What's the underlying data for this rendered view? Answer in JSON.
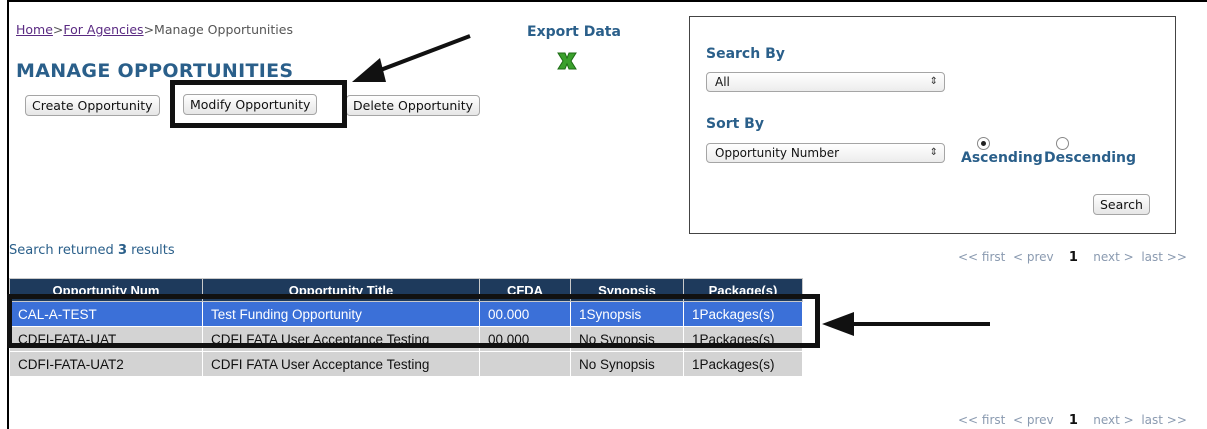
{
  "breadcrumb": {
    "home": "Home",
    "sep1": ">",
    "agencies": "For Agencies",
    "sep2": ">",
    "current": "Manage Opportunities"
  },
  "page_title": "MANAGE OPPORTUNITIES",
  "buttons": {
    "create": "Create Opportunity",
    "modify": "Modify Opportunity",
    "delete": "Delete Opportunity",
    "search": "Search"
  },
  "export": {
    "label": "Export Data",
    "icon": "excel-export-icon"
  },
  "search_panel": {
    "search_by_label": "Search By",
    "search_by_value": "All",
    "sort_by_label": "Sort By",
    "sort_by_value": "Opportunity Number",
    "ascending_label": "Ascending",
    "descending_label": "Descending",
    "order_selected": "Ascending"
  },
  "results": {
    "prefix": "Search returned ",
    "count": "3",
    "suffix": " results"
  },
  "pager": {
    "first": "<< first",
    "prev": "< prev",
    "page": "1",
    "next": "next >",
    "last": "last >>"
  },
  "table": {
    "headers": [
      "Opportunity Num",
      "Opportunity Title",
      "CFDA",
      "Synopsis",
      "Package(s)"
    ],
    "rows": [
      [
        "CAL-A-TEST",
        "Test Funding Opportunity",
        "00.000",
        "1Synopsis",
        "1Packages(s)"
      ],
      [
        "CDFI-FATA-UAT",
        "CDFI FATA User Acceptance Testing",
        "00.000",
        "No Synopsis",
        "1Packages(s)"
      ],
      [
        "CDFI-FATA-UAT2",
        "CDFI FATA User Acceptance Testing",
        "",
        "No Synopsis",
        "1Packages(s)"
      ]
    ],
    "selected_row": 0
  },
  "colors": {
    "accent": "#2a5f8a",
    "header_bg": "#1e3a5c",
    "selected_row": "#3b70d8",
    "row_bg": "#d3d3d3"
  }
}
